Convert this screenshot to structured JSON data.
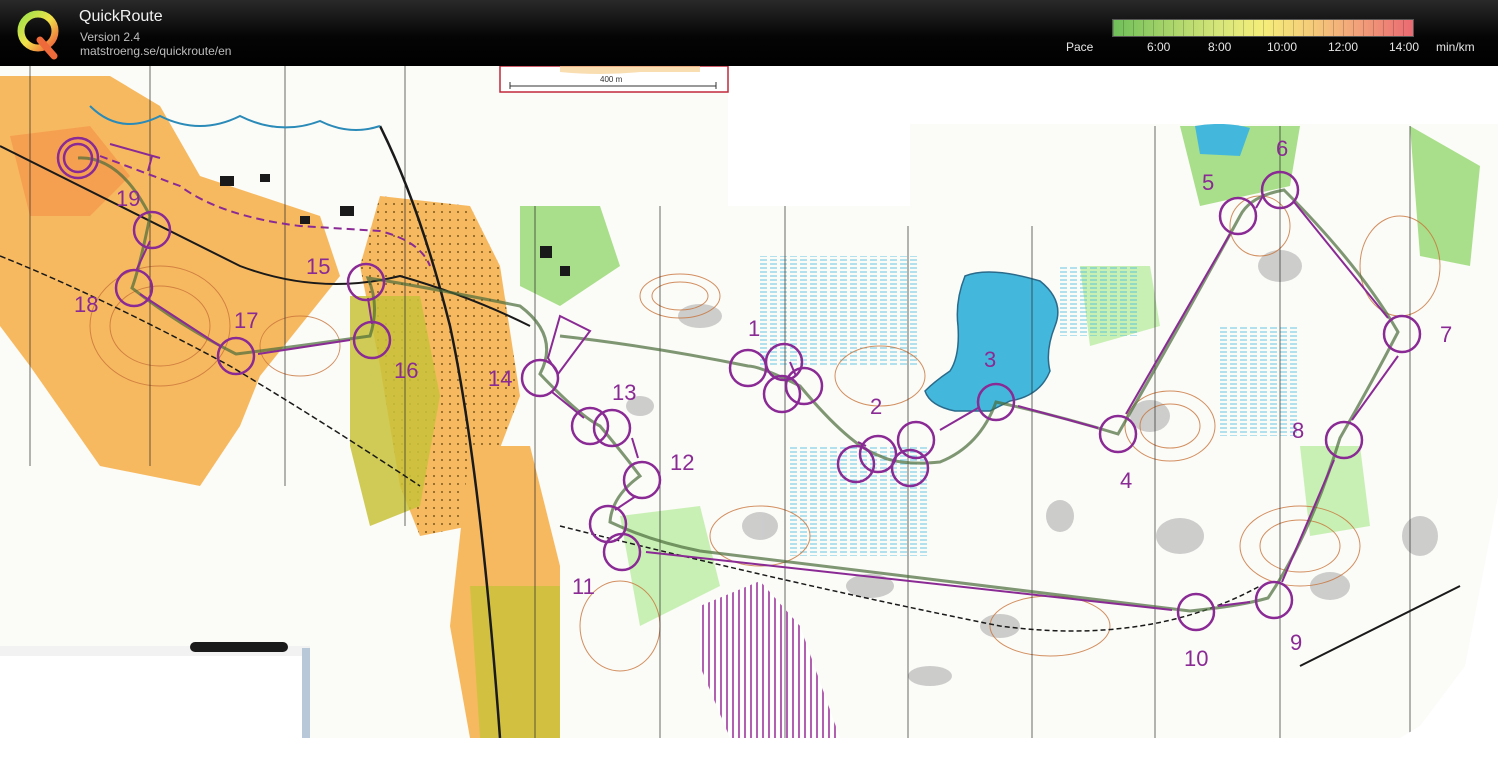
{
  "app": {
    "title": "QuickRoute",
    "version": "Version 2.4",
    "url": "matstroeng.se/quickroute/en"
  },
  "pace_scale": {
    "label": "Pace",
    "ticks": [
      "6:00",
      "8:00",
      "10:00",
      "12:00",
      "14:00"
    ],
    "unit": "min/km"
  },
  "map": {
    "scale_bar_label": "400 m",
    "control_labels": [
      "1",
      "2",
      "3",
      "4",
      "5",
      "6",
      "7",
      "8",
      "9",
      "10",
      "11",
      "12",
      "13",
      "14",
      "15",
      "16",
      "17",
      "18",
      "19"
    ]
  },
  "colors": {
    "course": "#8a2a94",
    "route": "#4a6b3a",
    "water": "#44b8dc",
    "open_land": "#f7b960",
    "forest_green": "#a9df8a",
    "rough": "#c8c23a",
    "contour": "#c8743a",
    "rock": "#b8b8b8"
  }
}
